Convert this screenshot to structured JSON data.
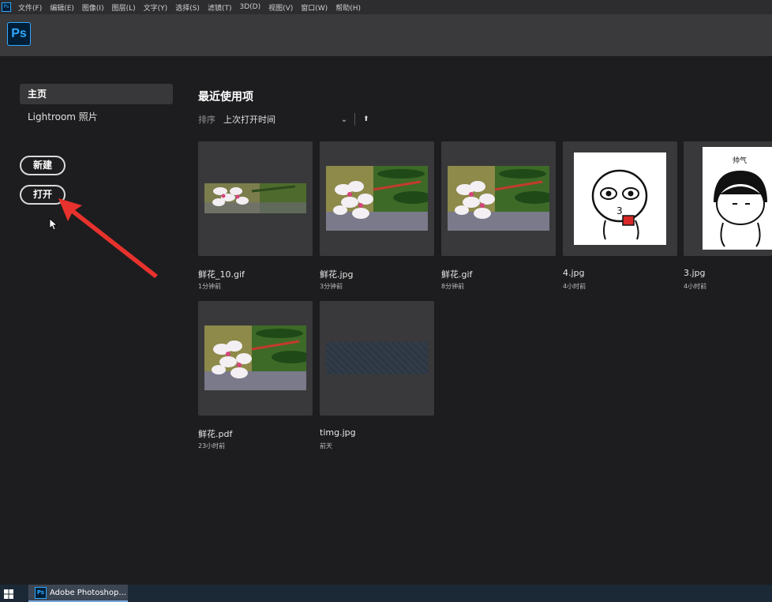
{
  "menu": {
    "items": [
      "文件(F)",
      "编辑(E)",
      "图像(I)",
      "图层(L)",
      "文字(Y)",
      "选择(S)",
      "滤镜(T)",
      "3D(D)",
      "视图(V)",
      "窗口(W)",
      "帮助(H)"
    ]
  },
  "header": {
    "logo": "Ps"
  },
  "sidebar": {
    "nav": [
      {
        "label": "主页",
        "active": true
      },
      {
        "label": "Lightroom 照片",
        "active": false
      }
    ],
    "new_label": "新建",
    "open_label": "打开"
  },
  "recent": {
    "title": "最近使用项",
    "sort_label": "排序",
    "sort_value": "上次打开时间",
    "sort_direction_icon": "arrow-up-icon",
    "files": [
      {
        "name": "鲜花_10.gif",
        "time": "1分钟前",
        "thumb": "flower-wide"
      },
      {
        "name": "鲜花.jpg",
        "time": "3分钟前",
        "thumb": "flower"
      },
      {
        "name": "鲜花.gif",
        "time": "8分钟前",
        "thumb": "flower"
      },
      {
        "name": "4.jpg",
        "time": "4小时前",
        "thumb": "cartoon-drink"
      },
      {
        "name": "3.jpg",
        "time": "4小时前",
        "thumb": "cartoon-face"
      },
      {
        "name": "鲜花.pdf",
        "time": "23小时前",
        "thumb": "flower"
      },
      {
        "name": "timg.jpg",
        "time": "前天",
        "thumb": "noise"
      }
    ],
    "cartoon_caption": "帅气"
  },
  "taskbar": {
    "app_label": "Adobe Photoshop...",
    "app_icon": "Ps"
  },
  "colors": {
    "ps_blue": "#31a8ff",
    "arrow_red": "#e8322d"
  }
}
